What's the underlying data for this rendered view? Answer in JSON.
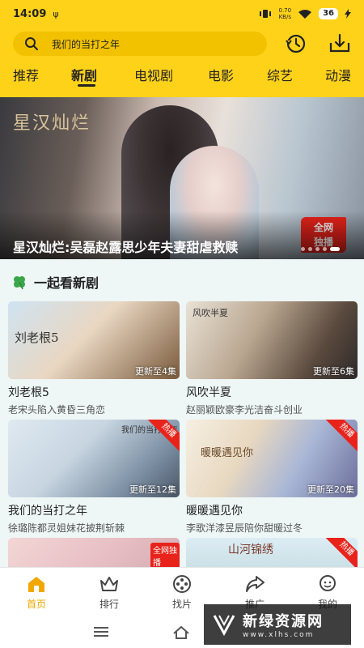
{
  "status": {
    "time": "14:09",
    "net_speed": "0.70",
    "net_unit": "KB/s",
    "battery": "36"
  },
  "search": {
    "placeholder": "我们的当打之年"
  },
  "tabs": [
    "推荐",
    "新剧",
    "电视剧",
    "电影",
    "综艺",
    "动漫"
  ],
  "active_tab": "新剧",
  "banner": {
    "logo_text": "星汉灿烂",
    "title": "星汉灿烂:吴磊赵露思少年夫妻甜虐救赎",
    "badge_line1": "全网",
    "badge_line2": "独播"
  },
  "section": {
    "icon": "clover-icon",
    "title": "一起看新剧"
  },
  "cards": [
    {
      "name": "刘老根5",
      "desc": "老宋头陷入黄昏三角恋",
      "episodes": "更新至4集",
      "hot": "",
      "poster_text": "刘老根5"
    },
    {
      "name": "风吹半夏",
      "desc": "赵丽颖欧豪李光洁奋斗创业",
      "episodes": "更新至6集",
      "hot": "",
      "poster_text": "风吹半夏"
    },
    {
      "name": "我们的当打之年",
      "desc": "徐璐陈都灵姐妹花披荆斩棘",
      "episodes": "更新至12集",
      "hot": "热播",
      "poster_text": "我们的当打之年"
    },
    {
      "name": "暖暖遇见你",
      "desc": "李歌洋漆昱辰陪你甜暖过冬",
      "episodes": "更新至20集",
      "hot": "热播",
      "poster_text": "暖暖遇见你"
    },
    {
      "name": "",
      "desc": "",
      "episodes": "",
      "hot": "",
      "poster_text": "全网独播"
    },
    {
      "name": "",
      "desc": "",
      "episodes": "",
      "hot": "热播",
      "poster_text": "山河锦绣"
    }
  ],
  "bottom_nav": [
    {
      "label": "首页",
      "icon": "home-icon",
      "active": true
    },
    {
      "label": "排行",
      "icon": "crown-icon",
      "active": false
    },
    {
      "label": "找片",
      "icon": "film-reel-icon",
      "active": false
    },
    {
      "label": "推广",
      "icon": "share-icon",
      "active": false
    },
    {
      "label": "我的",
      "icon": "user-icon",
      "active": false
    }
  ],
  "watermark": {
    "title": "新绿资源网",
    "url": "www.xlhs.com"
  },
  "colors": {
    "header": "#ffd21a",
    "search_bg": "#f2c200",
    "accent": "#f0a800",
    "badge_red": "#e8231b",
    "page_bg": "#eef6f6"
  }
}
